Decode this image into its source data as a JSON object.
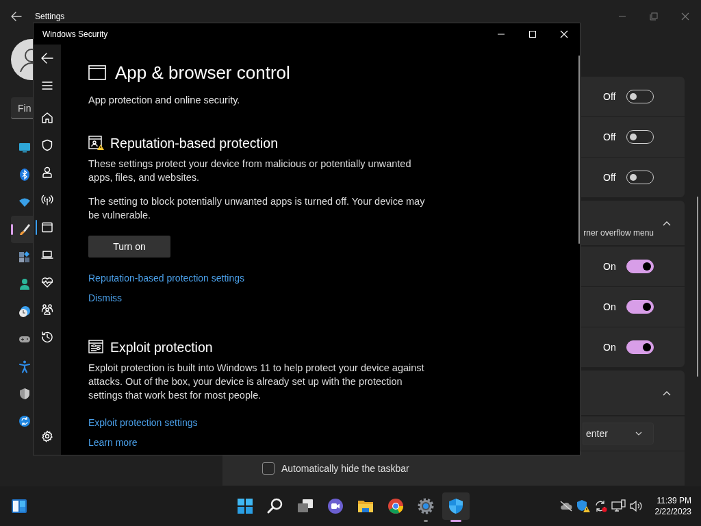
{
  "settings": {
    "title": "Settings",
    "search": {
      "placeholder": "Fin"
    },
    "nav": [
      {
        "selected": false
      },
      {
        "selected": false
      },
      {
        "selected": false
      },
      {
        "selected": true
      },
      {
        "selected": false
      },
      {
        "selected": false
      },
      {
        "selected": false
      },
      {
        "selected": false
      },
      {
        "selected": false
      },
      {
        "selected": false
      },
      {
        "selected": false
      }
    ],
    "rows": [
      {
        "kind": "toggle",
        "state_label": "Off",
        "on": false
      },
      {
        "kind": "toggle",
        "state_label": "Off",
        "on": false
      },
      {
        "kind": "toggle",
        "state_label": "Off",
        "on": false
      },
      {
        "kind": "group",
        "label": "rner overflow menu",
        "expanded": true
      },
      {
        "kind": "toggle",
        "state_label": "On",
        "on": true
      },
      {
        "kind": "toggle",
        "state_label": "On",
        "on": true
      },
      {
        "kind": "toggle",
        "state_label": "On",
        "on": true
      },
      {
        "kind": "group",
        "expanded": true
      },
      {
        "kind": "dropdown",
        "value": "enter"
      },
      {
        "kind": "checkbox",
        "label": "Automatically hide the taskbar",
        "checked": false
      }
    ]
  },
  "security": {
    "title": "Windows Security",
    "nav": [
      {
        "selected": false
      },
      {
        "selected": false
      },
      {
        "selected": false
      },
      {
        "selected": false
      },
      {
        "selected": true
      },
      {
        "selected": false
      },
      {
        "selected": false
      },
      {
        "selected": false
      },
      {
        "selected": false
      }
    ],
    "page_title": "App & browser control",
    "page_subtitle": "App protection and online security.",
    "sections": [
      {
        "heading": "Reputation-based protection",
        "paragraphs": [
          "These settings protect your device from malicious or potentially unwanted apps, files, and websites.",
          "The setting to block potentially unwanted apps is turned off. Your device may be vulnerable."
        ],
        "button": "Turn on",
        "links": [
          "Reputation-based protection settings",
          "Dismiss"
        ]
      },
      {
        "heading": "Exploit protection",
        "paragraphs": [
          "Exploit protection is built into Windows 11 to help protect your device against attacks.  Out of the box, your device is already set up with the protection settings that work best for most people."
        ],
        "links": [
          "Exploit protection settings",
          "Learn more"
        ]
      }
    ]
  },
  "taskbar": {
    "apps": [
      {
        "running": false,
        "active": false
      },
      {
        "running": false,
        "active": false
      },
      {
        "running": false,
        "active": false
      },
      {
        "running": false,
        "active": false
      },
      {
        "running": false,
        "active": false
      },
      {
        "running": false,
        "active": false
      },
      {
        "running": true,
        "active": false
      },
      {
        "running": true,
        "active": true
      }
    ],
    "clock": {
      "time": "11:39 PM",
      "date": "2/22/2023"
    }
  }
}
